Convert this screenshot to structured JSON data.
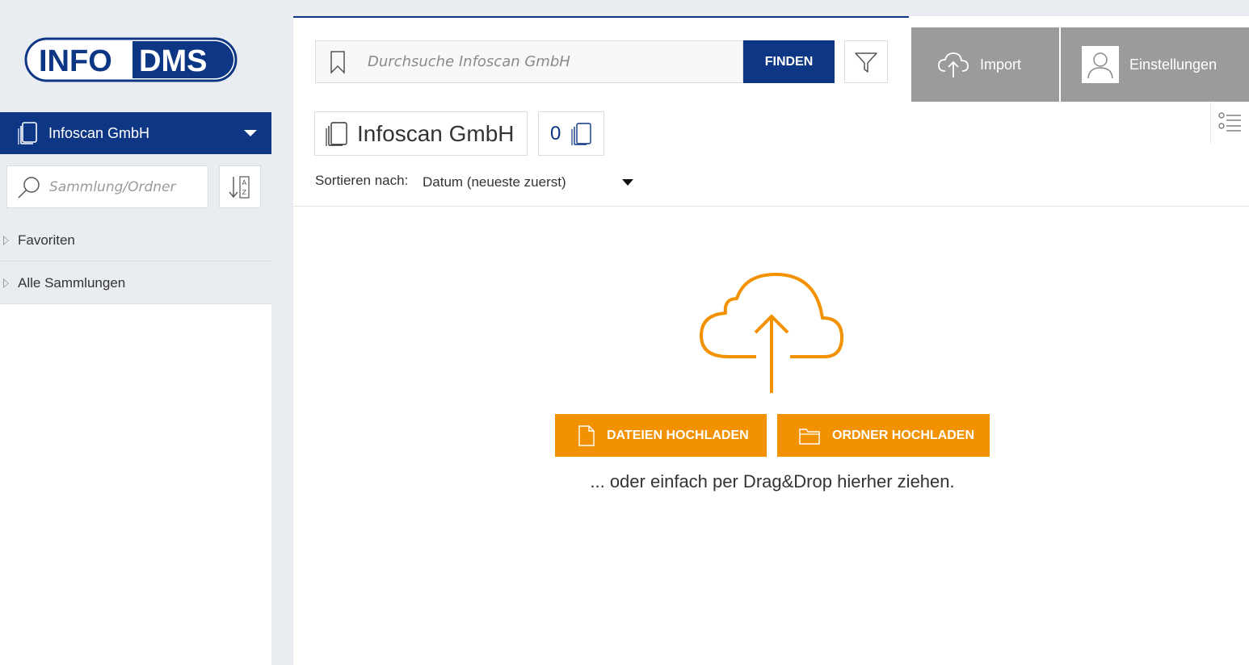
{
  "logo": {
    "part1": "INFO",
    "part2": "DMS",
    "brand_color": "#0d3685"
  },
  "sidebar": {
    "collection": {
      "label": "Infoscan GmbH",
      "icon": "documents-icon"
    },
    "search": {
      "placeholder": "Sammlung/Ordner",
      "icon": "search-icon"
    },
    "sort_icon": "sort-az-icon",
    "tree": [
      {
        "label": "Favoriten"
      },
      {
        "label": "Alle Sammlungen"
      }
    ]
  },
  "toolbar": {
    "search_placeholder": "Durchsuche Infoscan GmbH",
    "find_label": "FINDEN",
    "filter_icon": "filter-icon",
    "bookmark_icon": "bookmark-icon"
  },
  "tabs": {
    "import_label": "Import",
    "settings_label": "Einstellungen"
  },
  "content": {
    "title": "Infoscan GmbH",
    "count": "0",
    "sort_label": "Sortieren nach:",
    "sort_value": "Datum (neueste zuerst)",
    "upload_files_label": "DATEIEN HOCHLADEN",
    "upload_folder_label": "ORDNER HOCHLADEN",
    "drop_hint": "... oder einfach per Drag&Drop hierher ziehen."
  },
  "colors": {
    "primary": "#0d3685",
    "accent": "#f39200",
    "tab_gray": "#9b9b9b"
  }
}
